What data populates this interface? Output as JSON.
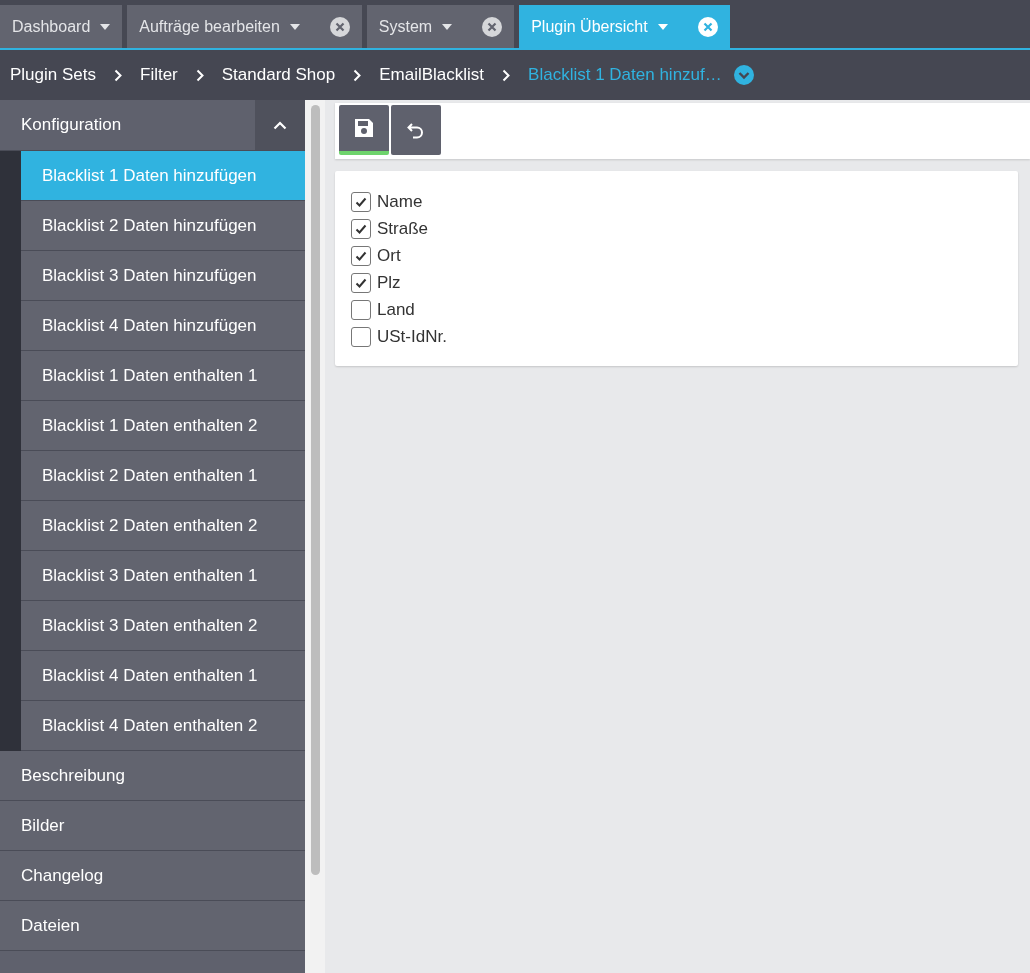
{
  "tabs": [
    {
      "label": "Dashboard",
      "selected": false,
      "closable": false
    },
    {
      "label": "Aufträge bearbeiten",
      "selected": false,
      "closable": true
    },
    {
      "label": "System",
      "selected": false,
      "closable": true
    },
    {
      "label": "Plugin Übersicht",
      "selected": true,
      "closable": true
    }
  ],
  "breadcrumb": [
    {
      "label": "Plugin Sets",
      "current": false
    },
    {
      "label": "Filter",
      "current": false
    },
    {
      "label": "Standard Shop",
      "current": false
    },
    {
      "label": "EmailBlacklist",
      "current": false
    },
    {
      "label": "Blacklist 1 Daten hinzuf…",
      "current": true
    }
  ],
  "sidebar": {
    "sections": [
      {
        "label": "Konfiguration",
        "expanded": true,
        "children": [
          {
            "label": "Blacklist 1 Daten hinzufügen",
            "selected": true
          },
          {
            "label": "Blacklist 2 Daten hinzufügen",
            "selected": false
          },
          {
            "label": "Blacklist 3 Daten hinzufügen",
            "selected": false
          },
          {
            "label": "Blacklist 4 Daten hinzufügen",
            "selected": false
          },
          {
            "label": "Blacklist 1 Daten enthalten 1",
            "selected": false
          },
          {
            "label": "Blacklist 1 Daten enthalten 2",
            "selected": false
          },
          {
            "label": "Blacklist 2 Daten enthalten 1",
            "selected": false
          },
          {
            "label": "Blacklist 2 Daten enthalten 2",
            "selected": false
          },
          {
            "label": "Blacklist 3 Daten enthalten 1",
            "selected": false
          },
          {
            "label": "Blacklist 3 Daten enthalten 2",
            "selected": false
          },
          {
            "label": "Blacklist 4 Daten enthalten 1",
            "selected": false
          },
          {
            "label": "Blacklist 4 Daten enthalten 2",
            "selected": false
          }
        ]
      },
      {
        "label": "Beschreibung",
        "selected": false
      },
      {
        "label": "Bilder",
        "selected": false
      },
      {
        "label": "Changelog",
        "selected": false
      },
      {
        "label": "Dateien",
        "selected": false
      }
    ]
  },
  "fields": [
    {
      "label": "Name",
      "checked": true
    },
    {
      "label": "Straße",
      "checked": true
    },
    {
      "label": "Ort",
      "checked": true
    },
    {
      "label": "Plz",
      "checked": true
    },
    {
      "label": "Land",
      "checked": false
    },
    {
      "label": "USt-IdNr.",
      "checked": false
    }
  ]
}
